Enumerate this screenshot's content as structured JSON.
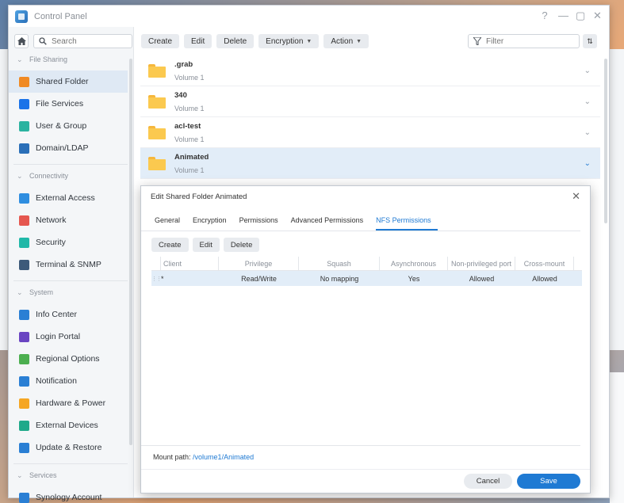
{
  "window": {
    "title": "Control Panel",
    "controls": [
      "?",
      "—",
      "▢",
      "✕"
    ]
  },
  "sidebar": {
    "search_placeholder": "Search",
    "sections": [
      {
        "title": "File Sharing",
        "items": [
          {
            "label": "Shared Folder",
            "icon": "shared-folder-icon",
            "color": "#f08a24",
            "active": true
          },
          {
            "label": "File Services",
            "icon": "file-services-icon",
            "color": "#1a73e8"
          },
          {
            "label": "User & Group",
            "icon": "user-group-icon",
            "color": "#2bb3a0"
          },
          {
            "label": "Domain/LDAP",
            "icon": "domain-ldap-icon",
            "color": "#2a6fb8"
          }
        ]
      },
      {
        "title": "Connectivity",
        "items": [
          {
            "label": "External Access",
            "icon": "external-access-icon",
            "color": "#2f8ee0"
          },
          {
            "label": "Network",
            "icon": "network-icon",
            "color": "#e5574f"
          },
          {
            "label": "Security",
            "icon": "security-shield-icon",
            "color": "#20b8a8"
          },
          {
            "label": "Terminal & SNMP",
            "icon": "terminal-icon",
            "color": "#3d5a7a"
          }
        ]
      },
      {
        "title": "System",
        "items": [
          {
            "label": "Info Center",
            "icon": "info-icon",
            "color": "#2a7fd4"
          },
          {
            "label": "Login Portal",
            "icon": "login-portal-icon",
            "color": "#6a45c2"
          },
          {
            "label": "Regional Options",
            "icon": "regional-options-icon",
            "color": "#4caf50"
          },
          {
            "label": "Notification",
            "icon": "notification-icon",
            "color": "#2a7fd4"
          },
          {
            "label": "Hardware & Power",
            "icon": "hardware-power-icon",
            "color": "#f5a623"
          },
          {
            "label": "External Devices",
            "icon": "external-devices-icon",
            "color": "#1fa98a"
          },
          {
            "label": "Update & Restore",
            "icon": "update-restore-icon",
            "color": "#2a7fd4"
          }
        ]
      },
      {
        "title": "Services",
        "items": [
          {
            "label": "Synology Account",
            "icon": "synology-account-icon",
            "color": "#2a7fd4"
          }
        ]
      }
    ]
  },
  "toolbar": {
    "create": "Create",
    "edit": "Edit",
    "delete": "Delete",
    "encryption": "Encryption",
    "action": "Action",
    "filter_placeholder": "Filter"
  },
  "folders": [
    {
      "name": ".grab",
      "volume": "Volume 1"
    },
    {
      "name": "340",
      "volume": "Volume 1"
    },
    {
      "name": "acl-test",
      "volume": "Volume 1"
    },
    {
      "name": "Animated",
      "volume": "Volume 1",
      "selected": true
    }
  ],
  "dialog": {
    "title": "Edit Shared Folder Animated",
    "tabs": [
      "General",
      "Encryption",
      "Permissions",
      "Advanced Permissions",
      "NFS Permissions"
    ],
    "active_tab": "NFS Permissions",
    "buttons": {
      "create": "Create",
      "edit": "Edit",
      "delete": "Delete"
    },
    "columns": [
      "Client",
      "Privilege",
      "Squash",
      "Asynchronous",
      "Non-privileged port",
      "Cross-mount"
    ],
    "rows": [
      {
        "client": "*",
        "privilege": "Read/Write",
        "squash": "No mapping",
        "async": "Yes",
        "nonpriv": "Allowed",
        "cross": "Allowed"
      }
    ],
    "mount_path_label": "Mount path:",
    "mount_path": "/volume1/Animated",
    "cancel": "Cancel",
    "save": "Save"
  }
}
